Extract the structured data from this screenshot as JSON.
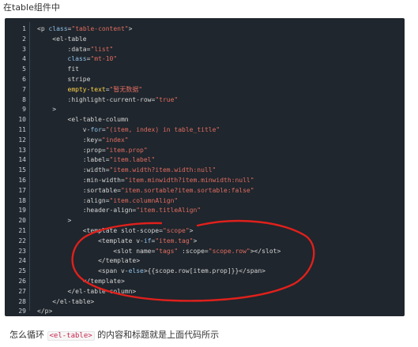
{
  "intro_text": "在table组件中",
  "code": {
    "line_numbers": [
      "1",
      "2",
      "3",
      "4",
      "5",
      "6",
      "7",
      "8",
      "9",
      "10",
      "11",
      "12",
      "13",
      "14",
      "15",
      "16",
      "17",
      "18",
      "19",
      "20",
      "21",
      "22",
      "23",
      "24",
      "25",
      "26",
      "27",
      "28",
      "29"
    ],
    "lines": [
      [
        {
          "c": "t",
          "x": "<p "
        },
        {
          "c": "a",
          "x": "class"
        },
        {
          "c": "t",
          "x": "="
        },
        {
          "c": "v",
          "x": "\"table-content\""
        },
        {
          "c": "t",
          "x": ">"
        }
      ],
      [
        {
          "c": "t",
          "x": "    <el-table"
        }
      ],
      [
        {
          "c": "t",
          "x": "        :data="
        },
        {
          "c": "v",
          "x": "\"list\""
        }
      ],
      [
        {
          "c": "t",
          "x": "        "
        },
        {
          "c": "a",
          "x": "class"
        },
        {
          "c": "t",
          "x": "="
        },
        {
          "c": "v",
          "x": "\"mt-10\""
        }
      ],
      [
        {
          "c": "t",
          "x": "        fit"
        }
      ],
      [
        {
          "c": "t",
          "x": "        stripe"
        }
      ],
      [
        {
          "c": "t",
          "x": "        "
        },
        {
          "c": "k",
          "x": "empty-text"
        },
        {
          "c": "t",
          "x": "="
        },
        {
          "c": "v",
          "x": "\"暂无数据\""
        }
      ],
      [
        {
          "c": "t",
          "x": "        :highlight-current-row="
        },
        {
          "c": "v",
          "x": "\"true\""
        }
      ],
      [
        {
          "c": "t",
          "x": "    >"
        }
      ],
      [
        {
          "c": "t",
          "x": "        <el-table-column"
        }
      ],
      [
        {
          "c": "t",
          "x": "            v-"
        },
        {
          "c": "a",
          "x": "for"
        },
        {
          "c": "t",
          "x": "="
        },
        {
          "c": "v",
          "x": "\"(item, index) in table_title\""
        }
      ],
      [
        {
          "c": "t",
          "x": "            :key="
        },
        {
          "c": "v",
          "x": "\"index\""
        }
      ],
      [
        {
          "c": "t",
          "x": "            :prop="
        },
        {
          "c": "v",
          "x": "\"item.prop\""
        }
      ],
      [
        {
          "c": "t",
          "x": "            :label="
        },
        {
          "c": "v",
          "x": "\"item.label\""
        }
      ],
      [
        {
          "c": "t",
          "x": "            :width="
        },
        {
          "c": "v",
          "x": "\"item.width?item.width:null\""
        }
      ],
      [
        {
          "c": "t",
          "x": "            :min-width="
        },
        {
          "c": "v",
          "x": "\"item.minwidth?item.minwidth:null\""
        }
      ],
      [
        {
          "c": "t",
          "x": "            :sortable="
        },
        {
          "c": "v",
          "x": "\"item.sortable?item.sortable:false\""
        }
      ],
      [
        {
          "c": "t",
          "x": "            :align="
        },
        {
          "c": "v",
          "x": "\"item.columnAlign\""
        }
      ],
      [
        {
          "c": "t",
          "x": "            :header-align="
        },
        {
          "c": "v",
          "x": "\"item.titleAlign\""
        }
      ],
      [
        {
          "c": "t",
          "x": "        >"
        }
      ],
      [
        {
          "c": "t",
          "x": "            <template slot-scope="
        },
        {
          "c": "v",
          "x": "\"scope\""
        },
        {
          "c": "t",
          "x": ">"
        }
      ],
      [
        {
          "c": "t",
          "x": "                <template v-"
        },
        {
          "c": "a",
          "x": "if"
        },
        {
          "c": "t",
          "x": "="
        },
        {
          "c": "v",
          "x": "\"item.tag\""
        },
        {
          "c": "t",
          "x": ">"
        }
      ],
      [
        {
          "c": "t",
          "x": "                    <slot name="
        },
        {
          "c": "v",
          "x": "\"tags\""
        },
        {
          "c": "t",
          "x": " :scope="
        },
        {
          "c": "v",
          "x": "\"scope.row\""
        },
        {
          "c": "t",
          "x": "></slot>"
        }
      ],
      [
        {
          "c": "t",
          "x": "                </template>"
        }
      ],
      [
        {
          "c": "t",
          "x": "                <span v-"
        },
        {
          "c": "a",
          "x": "else"
        },
        {
          "c": "t",
          "x": ">{{scope.row[item.prop]}}</span>"
        }
      ],
      [
        {
          "c": "t",
          "x": "            </template>"
        }
      ],
      [
        {
          "c": "t",
          "x": "        </el-table-column>"
        }
      ],
      [
        {
          "c": "t",
          "x": "    </el-table>"
        }
      ],
      [
        {
          "c": "t",
          "x": "</p>"
        }
      ]
    ]
  },
  "outro": {
    "before": "怎么循环",
    "code": "<el-table>",
    "after": "的内容和标题就是上面代码所示"
  },
  "colors": {
    "code_bg": "#1f262d",
    "string": "#e06c60",
    "keyword": "#8fc0e8",
    "highlight": "#ffd24a",
    "annotation": "#e0201c"
  }
}
